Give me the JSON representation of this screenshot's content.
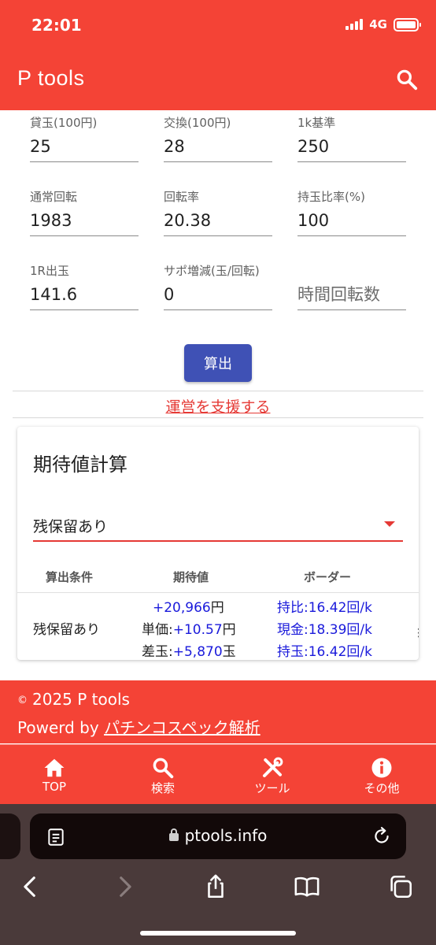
{
  "status_bar": {
    "time": "22:01",
    "network": "4G"
  },
  "app_bar": {
    "title": "P tools"
  },
  "form": {
    "fields": [
      {
        "label": "貸玉(100円)",
        "value": "25"
      },
      {
        "label": "交換(100円)",
        "value": "28"
      },
      {
        "label": "1k基準",
        "value": "250"
      },
      {
        "label": "通常回転",
        "value": "1983"
      },
      {
        "label": "回転率",
        "value": "20.38"
      },
      {
        "label": "持玉比率(%)",
        "value": "100"
      },
      {
        "label": "1R出玉",
        "value": "141.6"
      },
      {
        "label": "サポ増減(玉/回転)",
        "value": "0"
      },
      {
        "label": "",
        "placeholder": "時間回転数"
      }
    ],
    "calc_button": "算出"
  },
  "support_link": "運営を支援する",
  "card": {
    "title": "期待値計算",
    "select_value": "残保留あり",
    "headers": [
      "算出条件",
      "期待値",
      "ボーダー"
    ],
    "row": {
      "condition": "残保留あり",
      "expected_total": "+20,966",
      "expected_total_unit": "円",
      "unit_price_label": "単価:",
      "unit_price": "+10.57",
      "unit_price_unit": "円",
      "diff_label": "差玉:",
      "diff": "+5,870",
      "diff_unit": "玉",
      "borders": [
        "持比:16.42回/k",
        "現金:18.39回/k",
        "持玉:16.42回/k"
      ]
    }
  },
  "footer": {
    "copyright": "2025 P tools",
    "powered_prefix": "Powerd by ",
    "powered_link": "パチンコスペック解析"
  },
  "bottom_nav": [
    {
      "label": "TOP",
      "icon": "home-icon"
    },
    {
      "label": "検索",
      "icon": "search-icon"
    },
    {
      "label": "ツール",
      "icon": "tools-icon"
    },
    {
      "label": "その他",
      "icon": "info-icon"
    }
  ],
  "browser": {
    "url": "ptools.info"
  },
  "colors": {
    "primary": "#f44336",
    "button": "#3f51b5",
    "link_blue": "#1a1adb"
  }
}
